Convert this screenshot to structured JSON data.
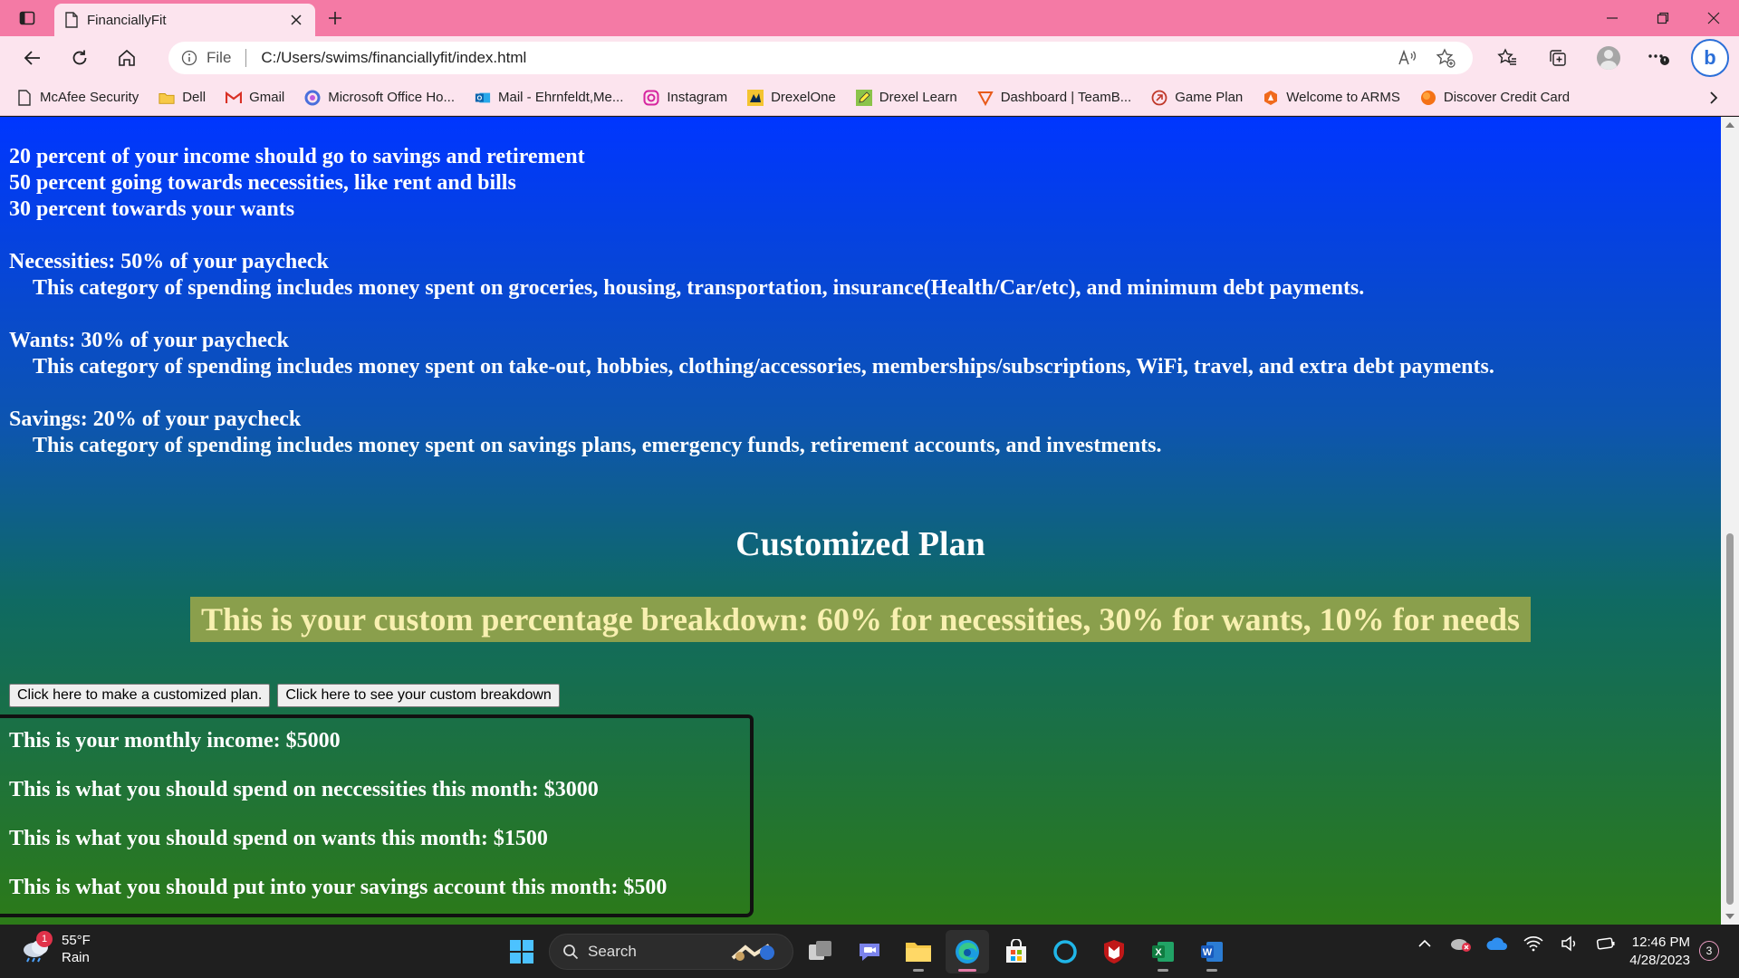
{
  "browser": {
    "tab_title": "FinanciallyFit",
    "address_prefix": "File",
    "url": "C:/Users/swims/financiallyfit/index.html"
  },
  "favorites": [
    {
      "label": "McAfee Security",
      "icon": "page-icon"
    },
    {
      "label": "Dell",
      "icon": "folder-icon"
    },
    {
      "label": "Gmail",
      "icon": "gmail-icon"
    },
    {
      "label": "Microsoft Office Ho...",
      "icon": "office-icon"
    },
    {
      "label": "Mail - Ehrnfeldt,Me...",
      "icon": "outlook-icon"
    },
    {
      "label": "Instagram",
      "icon": "instagram-icon"
    },
    {
      "label": "DrexelOne",
      "icon": "drexel-dragon-icon"
    },
    {
      "label": "Drexel Learn",
      "icon": "pencil-icon"
    },
    {
      "label": "Dashboard | TeamB...",
      "icon": "teamb-icon"
    },
    {
      "label": "Game Plan",
      "icon": "gameplan-icon"
    },
    {
      "label": "Welcome to ARMS",
      "icon": "arms-icon"
    },
    {
      "label": "Discover Credit Card",
      "icon": "discover-icon"
    }
  ],
  "content": {
    "rules": [
      "20 percent of your income should go to savings and retirement",
      "50 percent going towards necessities, like rent and bills",
      "30 percent towards your wants"
    ],
    "categories": [
      {
        "title": "Necessities: 50% of your paycheck",
        "description": "This category of spending includes money spent on groceries, housing, transportation, insurance(Health/Car/etc), and minimum debt payments."
      },
      {
        "title": "Wants: 30% of your paycheck",
        "description": "This category of spending includes money spent on take-out, hobbies, clothing/accessories, memberships/subscriptions, WiFi, travel, and extra debt payments."
      },
      {
        "title": "Savings: 20% of your paycheck",
        "description": "This category of spending includes money spent on savings plans, emergency funds, retirement accounts, and investments."
      }
    ],
    "custom_heading": "Customized Plan",
    "custom_breakdown": "This is your custom percentage breakdown: 60% for necessities, 30% for wants, 10% for needs",
    "buttons": {
      "make_plan": "Click here to make a customized plan.",
      "see_breakdown": "Click here to see your custom breakdown"
    },
    "results": [
      "This is your monthly income: $5000",
      "This is what you should spend on neccessities this month: $3000",
      "This is what you should spend on wants this month: $1500",
      "This is what you should put into your savings account this month: $500"
    ]
  },
  "taskbar": {
    "weather_temp": "55°F",
    "weather_cond": "Rain",
    "weather_badge": "1",
    "search_label": "Search",
    "time": "12:46 PM",
    "date": "4/28/2023",
    "notification_count": "3"
  },
  "colors": {
    "titlebar": "#f47aa5",
    "toolbar": "#fce4ee",
    "page_gradient_top": "#0036ff",
    "page_gradient_bottom": "#2c7a18",
    "breakdown_bg": "#8a9f4c",
    "breakdown_text": "#f8f0b0"
  }
}
